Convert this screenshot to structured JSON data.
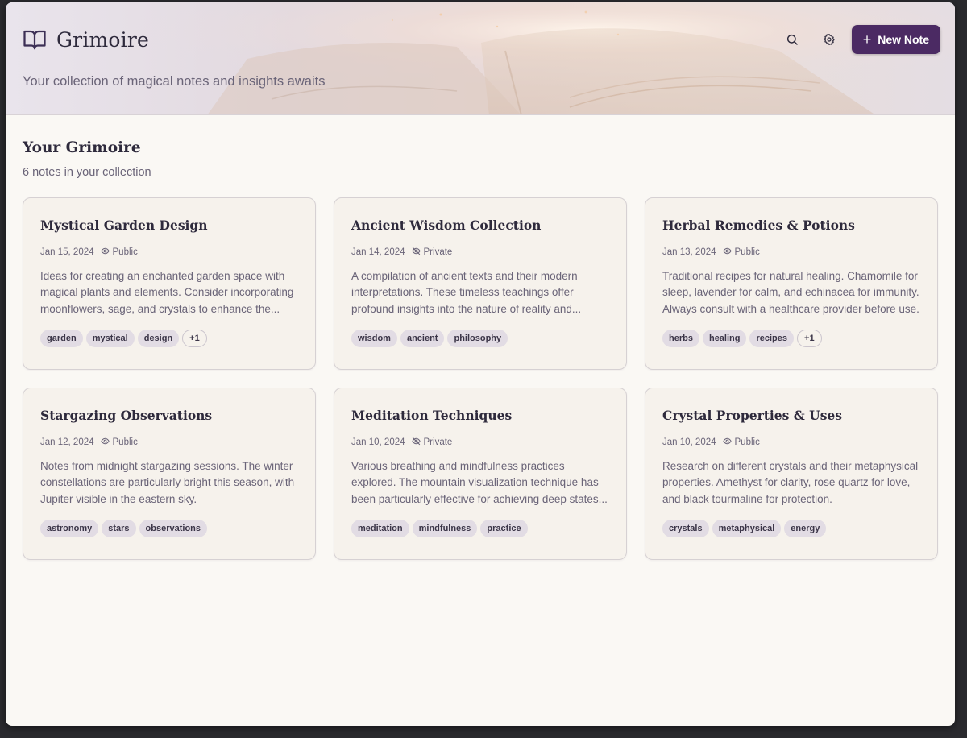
{
  "app": {
    "name": "Grimoire",
    "tagline": "Your collection of magical notes and insights awaits",
    "accent_color": "#4b2a63"
  },
  "header": {
    "search_icon": "search-icon",
    "settings_icon": "gear-icon",
    "new_note_label": "New Note"
  },
  "main": {
    "title": "Your Grimoire",
    "subtitle": "6 notes in your collection"
  },
  "notes": [
    {
      "title": "Mystical Garden Design",
      "date": "Jan 15, 2024",
      "visibility": "Public",
      "description": "Ideas for creating an enchanted garden space with magical plants and elements. Consider incorporating moonflowers, sage, and crystals to enhance the...",
      "tags": [
        "garden",
        "mystical",
        "design"
      ],
      "more": "+1"
    },
    {
      "title": "Ancient Wisdom Collection",
      "date": "Jan 14, 2024",
      "visibility": "Private",
      "description": "A compilation of ancient texts and their modern interpretations. These timeless teachings offer profound insights into the nature of reality and...",
      "tags": [
        "wisdom",
        "ancient",
        "philosophy"
      ],
      "more": ""
    },
    {
      "title": "Herbal Remedies & Potions",
      "date": "Jan 13, 2024",
      "visibility": "Public",
      "description": "Traditional recipes for natural healing. Chamomile for sleep, lavender for calm, and echinacea for immunity. Always consult with a healthcare provider before use.",
      "tags": [
        "herbs",
        "healing",
        "recipes"
      ],
      "more": "+1"
    },
    {
      "title": "Stargazing Observations",
      "date": "Jan 12, 2024",
      "visibility": "Public",
      "description": "Notes from midnight stargazing sessions. The winter constellations are particularly bright this season, with Jupiter visible in the eastern sky.",
      "tags": [
        "astronomy",
        "stars",
        "observations"
      ],
      "more": ""
    },
    {
      "title": "Meditation Techniques",
      "date": "Jan 10, 2024",
      "visibility": "Private",
      "description": "Various breathing and mindfulness practices explored. The mountain visualization technique has been particularly effective for achieving deep states...",
      "tags": [
        "meditation",
        "mindfulness",
        "practice"
      ],
      "more": ""
    },
    {
      "title": "Crystal Properties & Uses",
      "date": "Jan 10, 2024",
      "visibility": "Public",
      "description": "Research on different crystals and their metaphysical properties. Amethyst for clarity, rose quartz for love, and black tourmaline for protection.",
      "tags": [
        "crystals",
        "metaphysical",
        "energy"
      ],
      "more": ""
    }
  ]
}
